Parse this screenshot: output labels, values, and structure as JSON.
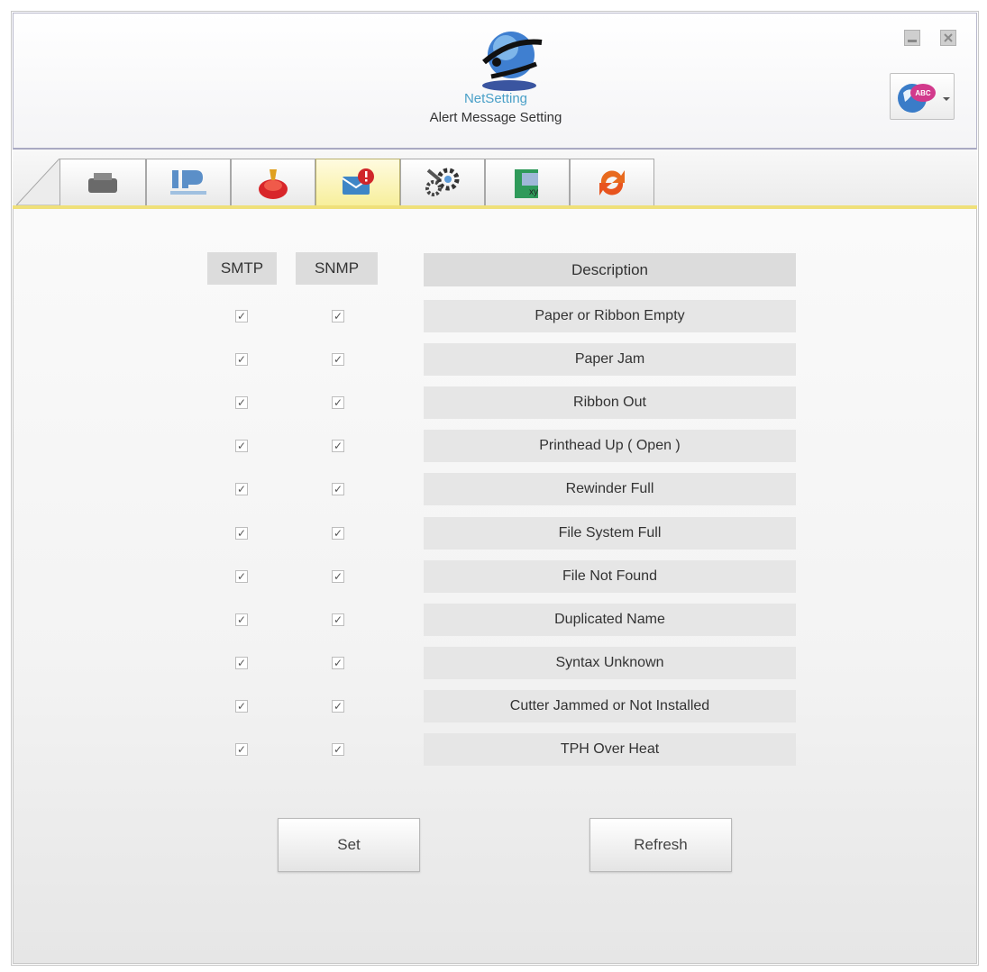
{
  "header": {
    "logo_text": "NetSetting",
    "subtitle": "Alert Message Setting",
    "language_badge": "ABC"
  },
  "columns": {
    "smtp": "SMTP",
    "snmp": "SNMP",
    "description": "Description"
  },
  "alerts": [
    {
      "description": "Paper or Ribbon Empty",
      "smtp": true,
      "snmp": true
    },
    {
      "description": "Paper Jam",
      "smtp": true,
      "snmp": true
    },
    {
      "description": "Ribbon Out",
      "smtp": true,
      "snmp": true
    },
    {
      "description": "Printhead Up ( Open )",
      "smtp": true,
      "snmp": true
    },
    {
      "description": "Rewinder Full",
      "smtp": true,
      "snmp": true
    },
    {
      "description": "File System Full",
      "smtp": true,
      "snmp": true
    },
    {
      "description": "File Not Found",
      "smtp": true,
      "snmp": true
    },
    {
      "description": "Duplicated Name",
      "smtp": true,
      "snmp": true
    },
    {
      "description": "Syntax Unknown",
      "smtp": true,
      "snmp": true
    },
    {
      "description": "Cutter Jammed or Not Installed",
      "smtp": true,
      "snmp": true
    },
    {
      "description": "TPH Over Heat",
      "smtp": true,
      "snmp": true
    }
  ],
  "buttons": {
    "set": "Set",
    "refresh": "Refresh"
  },
  "check_glyph": "✓",
  "tabs": [
    {
      "icon": "printer-icon",
      "active": false
    },
    {
      "icon": "ip-network-icon",
      "active": false
    },
    {
      "icon": "alarm-bell-icon",
      "active": false
    },
    {
      "icon": "alert-message-icon",
      "active": true
    },
    {
      "icon": "settings-gears-icon",
      "active": false
    },
    {
      "icon": "key-file-icon",
      "active": false
    },
    {
      "icon": "refresh-sync-icon",
      "active": false
    }
  ],
  "colors": {
    "active_tab": "#f7ef9c",
    "accent_line": "#efe07a",
    "header_cell": "#dcdcdc",
    "row_cell": "#e6e6e6"
  }
}
